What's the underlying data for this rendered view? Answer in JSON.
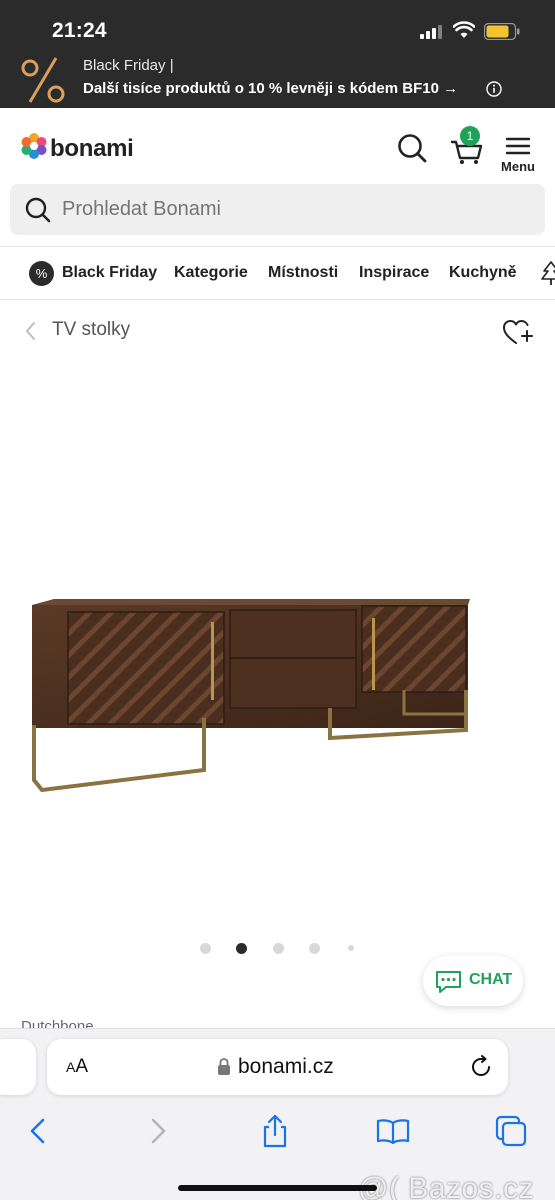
{
  "status_bar": {
    "time": "21:24"
  },
  "promo": {
    "line1": "Black Friday |",
    "line2": "Další tisíce produktů o 10 % levněji s kódem BF10 →",
    "icon": "percent-icon"
  },
  "header": {
    "logo_text": "bonami",
    "cart_count": "1",
    "menu_label": "Menu",
    "icons": [
      "search-icon",
      "cart-icon",
      "hamburger-icon"
    ]
  },
  "search": {
    "placeholder": "Prohledat Bonami"
  },
  "catnav": {
    "items": [
      "Black Friday",
      "Kategorie",
      "Místnosti",
      "Inspirace",
      "Kuchyně"
    ],
    "badge": "%"
  },
  "breadcrumb": {
    "label": "TV stolky"
  },
  "carousel": {
    "slide_count": 5,
    "active_index": 1
  },
  "chat": {
    "label": "CHAT"
  },
  "brand_peek": "Dutchbone",
  "safari": {
    "aa": "A",
    "aa_big": "A",
    "url": "bonami.cz"
  },
  "watermark": "@( Bazos.cz",
  "colors": {
    "accent_green": "#1fa25a",
    "dark": "#2b2b2b"
  }
}
